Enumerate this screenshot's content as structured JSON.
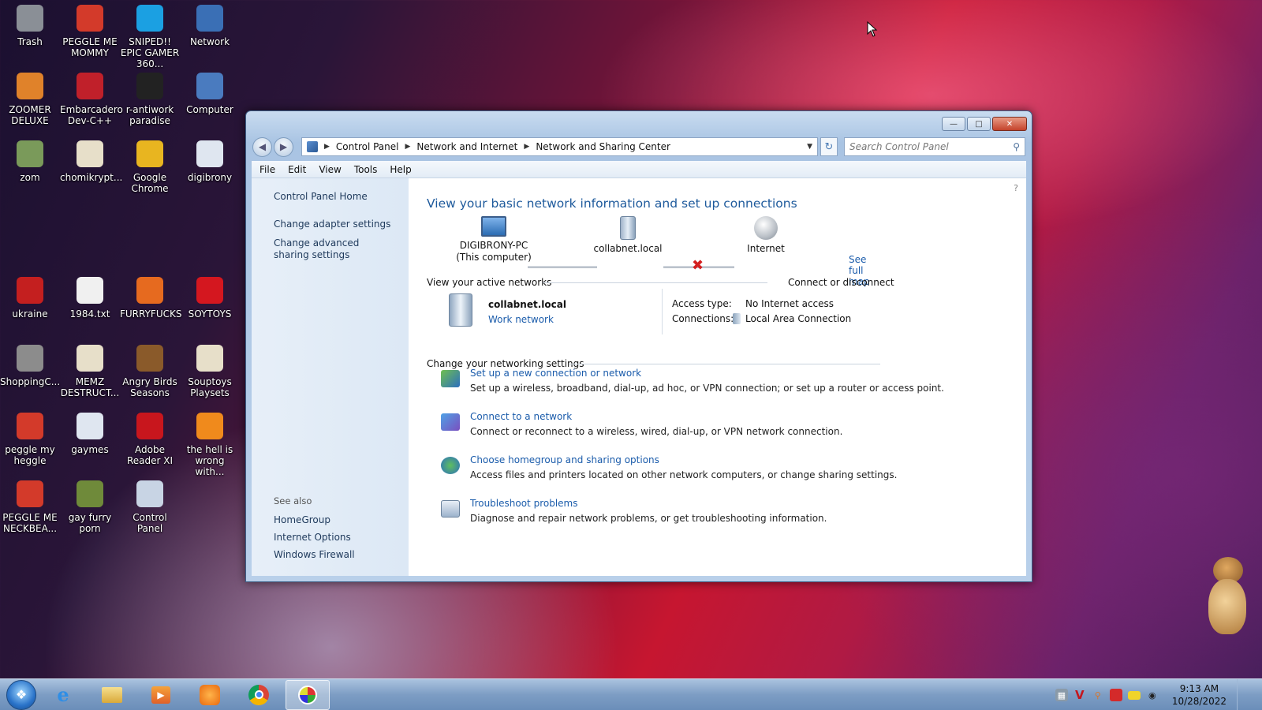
{
  "desktop": {
    "icons": [
      {
        "label": "Trash",
        "icon": "trash-icon",
        "color": "#8a8f96"
      },
      {
        "label": "PEGGLE ME MOMMY",
        "icon": "peggle-icon",
        "color": "#d33a2a"
      },
      {
        "label": "SNIPED!! EPIC GAMER 360...",
        "icon": "skype-icon",
        "color": "#1ba0e2"
      },
      {
        "label": "Network",
        "icon": "network-icon",
        "color": "#3a6fb5"
      },
      {
        "label": "ZOOMER DELUXE",
        "icon": "zoomer-icon",
        "color": "#e0822a"
      },
      {
        "label": "Embarcadero Dev-C++",
        "icon": "devcpp-icon",
        "color": "#c0202a"
      },
      {
        "label": "r-antiwork paradise",
        "icon": "reddit-icon",
        "color": "#222222"
      },
      {
        "label": "Computer",
        "icon": "computer-icon",
        "color": "#4a7bbf"
      },
      {
        "label": "zom",
        "icon": "zom-icon",
        "color": "#7a9a5a"
      },
      {
        "label": "chomikrypt...",
        "icon": "document-icon",
        "color": "#e7dfc9"
      },
      {
        "label": "Google Chrome",
        "icon": "chrome-icon",
        "color": "#e8b520"
      },
      {
        "label": "digibrony",
        "icon": "folder-icon",
        "color": "#dfe6f0"
      },
      {
        "label": "ukraine",
        "icon": "radiation-icon",
        "color": "#c41f1f"
      },
      {
        "label": "1984.txt",
        "icon": "text-file-icon",
        "color": "#f0f0f0"
      },
      {
        "label": "FURRYFUCKS",
        "icon": "firefox-icon",
        "color": "#e66a1f"
      },
      {
        "label": "SOYTOYS",
        "icon": "soytoys-icon",
        "color": "#d4171f"
      },
      {
        "label": "ShoppingC...",
        "icon": "flash-icon",
        "color": "#8c8c8c"
      },
      {
        "label": "MEMZ DESTRUCT...",
        "icon": "document-icon",
        "color": "#e7dfc9"
      },
      {
        "label": "Angry Birds Seasons",
        "icon": "angry-birds-icon",
        "color": "#8a5a2a"
      },
      {
        "label": "Souptoys Playsets",
        "icon": "document-icon",
        "color": "#e7dfc9"
      },
      {
        "label": "peggle my heggle",
        "icon": "peggle-icon",
        "color": "#d33a2a"
      },
      {
        "label": "gaymes",
        "icon": "folder-icon",
        "color": "#dfe6f0"
      },
      {
        "label": "Adobe Reader XI",
        "icon": "adobe-reader-icon",
        "color": "#c8161d"
      },
      {
        "label": "the hell is wrong with...",
        "icon": "uc-browser-icon",
        "color": "#f08a1c"
      },
      {
        "label": "PEGGLE ME NECKBEA...",
        "icon": "peggle-icon",
        "color": "#d33a2a"
      },
      {
        "label": "gay furry porn",
        "icon": "box-icon",
        "color": "#6f8a3a"
      },
      {
        "label": "Control Panel",
        "icon": "control-panel-icon",
        "color": "#c8d4e4"
      }
    ]
  },
  "window": {
    "address": {
      "segments": [
        "Control Panel",
        "Network and Internet",
        "Network and Sharing Center"
      ]
    },
    "search_placeholder": "Search Control Panel",
    "menu": [
      "File",
      "Edit",
      "View",
      "Tools",
      "Help"
    ],
    "left_pane": {
      "home": "Control Panel Home",
      "links": [
        "Change adapter settings",
        "Change advanced sharing settings"
      ],
      "see_also_title": "See also",
      "see_also": [
        "HomeGroup",
        "Internet Options",
        "Windows Firewall"
      ]
    },
    "main": {
      "heading": "View your basic network information and set up connections",
      "see_full_map": "See full map",
      "map_nodes": {
        "computer": "DIGIBRONY-PC",
        "computer_sub": "(This computer)",
        "network": "collabnet.local",
        "internet": "Internet"
      },
      "active_networks_title": "View your active networks",
      "connect_disconnect": "Connect or disconnect",
      "active_network": {
        "name": "collabnet.local",
        "type": "Work network",
        "access_type_label": "Access type:",
        "access_type_value": "No Internet access",
        "connections_label": "Connections:",
        "connections_value": "Local Area Connection"
      },
      "change_settings_title": "Change your networking settings",
      "tasks": [
        {
          "title": "Set up a new connection or network",
          "desc": "Set up a wireless, broadband, dial-up, ad hoc, or VPN connection; or set up a router or access point.",
          "icon": "new-connection-icon"
        },
        {
          "title": "Connect to a network",
          "desc": "Connect or reconnect to a wireless, wired, dial-up, or VPN network connection.",
          "icon": "connect-network-icon"
        },
        {
          "title": "Choose homegroup and sharing options",
          "desc": "Access files and printers located on other network computers, or change sharing settings.",
          "icon": "homegroup-icon"
        },
        {
          "title": "Troubleshoot problems",
          "desc": "Diagnose and repair network problems, or get troubleshooting information.",
          "icon": "troubleshoot-icon"
        }
      ]
    }
  },
  "taskbar": {
    "time": "9:13 AM",
    "date": "10/28/2022"
  },
  "colors": {
    "link": "#1b5cab",
    "heading": "#1e5a9c",
    "error_x": "#d42020"
  }
}
